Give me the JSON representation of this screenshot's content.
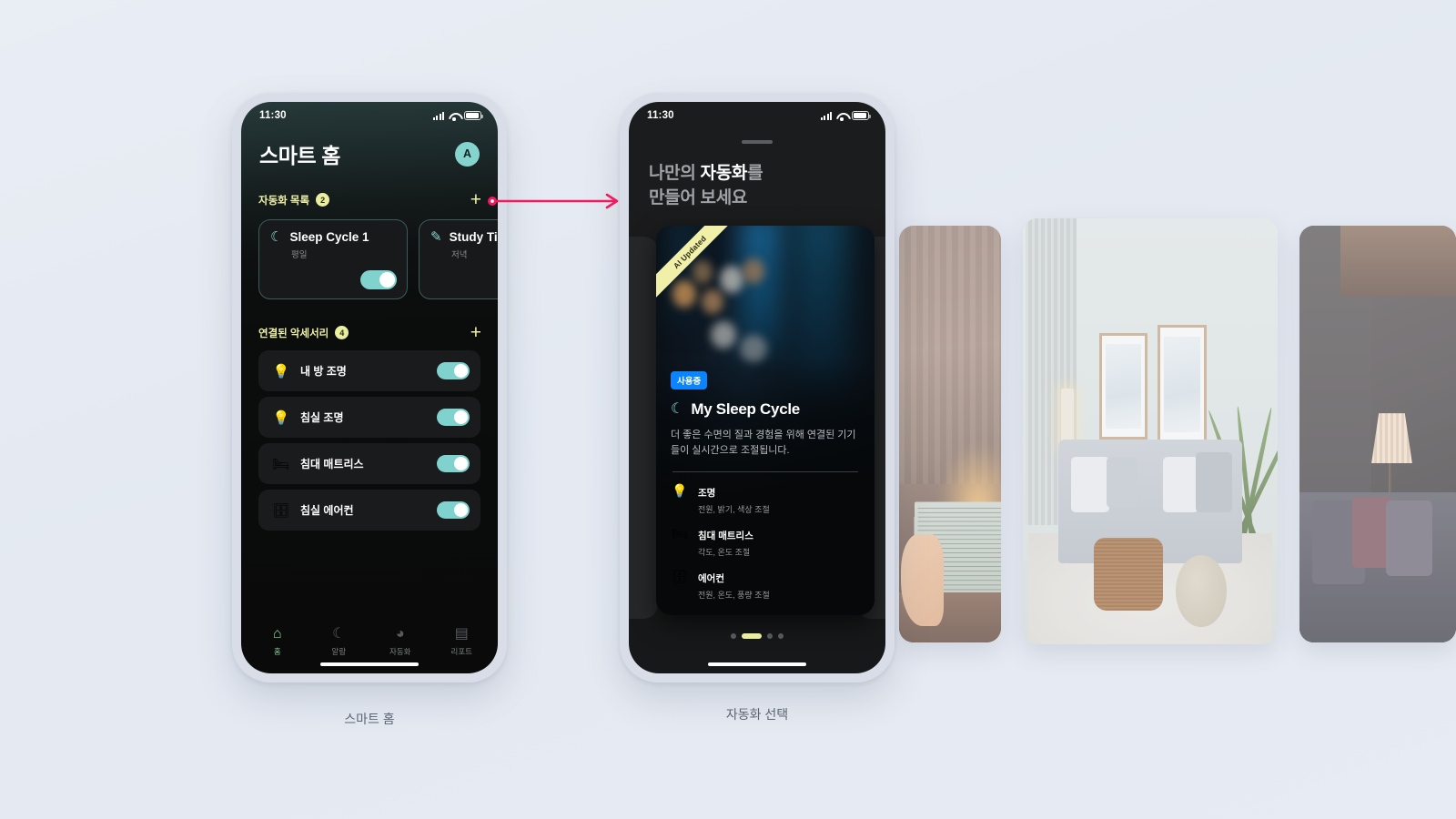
{
  "background_color": "#e7ebf3",
  "accent_colors": {
    "teal": "#7fd2cd",
    "yellow": "#e9eea0",
    "blue_badge": "#0a84ff",
    "arrow_pink": "#f2195f",
    "nav_active_green": "#8fd49a"
  },
  "phone_smart_home": {
    "caption": "스마트 홈",
    "status_bar": {
      "time": "11:30",
      "signal_icon": "cellular-signal-icon",
      "wifi_icon": "wifi-icon",
      "battery_icon": "battery-icon"
    },
    "header": {
      "title": "스마트 홈",
      "avatar_initial": "A"
    },
    "automation_section": {
      "label": "자동화 목록",
      "count": "2",
      "add_label": "+",
      "cards": [
        {
          "icon": "moon-icon",
          "glyph": "☾",
          "name": "Sleep Cycle 1",
          "subtitle": "평일",
          "toggle_on": true
        },
        {
          "icon": "pencil-icon",
          "glyph": "✎",
          "name": "Study Time",
          "subtitle": "저녁",
          "toggle_on": false
        }
      ]
    },
    "accessories_section": {
      "label": "연결된 악세서리",
      "count": "4",
      "add_label": "+",
      "items": [
        {
          "icon": "lightbulb-icon",
          "glyph": "💡",
          "name": "내 방 조명",
          "toggle_on": true
        },
        {
          "icon": "lightbulb-icon",
          "glyph": "💡",
          "name": "침실 조명",
          "toggle_on": true
        },
        {
          "icon": "bed-icon",
          "glyph": "🛏",
          "name": "침대 매트리스",
          "toggle_on": true
        },
        {
          "icon": "air-conditioner-icon",
          "glyph": "🗄",
          "name": "침실 에어컨",
          "toggle_on": true
        }
      ]
    },
    "tabbar": [
      {
        "icon": "home-icon",
        "glyph": "⌂",
        "label": "홈",
        "active": true
      },
      {
        "icon": "moon-icon",
        "glyph": "☾",
        "label": "알람",
        "active": false
      },
      {
        "icon": "clock-icon",
        "glyph": "◕",
        "label": "자동화",
        "active": false
      },
      {
        "icon": "report-icon",
        "glyph": "▤",
        "label": "리포트",
        "active": false
      }
    ]
  },
  "phone_automation": {
    "caption": "자동화 선택",
    "status_bar": {
      "time": "11:30",
      "signal_icon": "cellular-signal-icon",
      "wifi_icon": "wifi-icon",
      "battery_icon": "battery-icon"
    },
    "title_line1_normal": "나만의 ",
    "title_line1_bold": "자동화",
    "title_line1_tail": "를",
    "title_line2": "만들어 보세요",
    "hero_card": {
      "ribbon": "AI Updated",
      "badge": "사용중",
      "icon": "moon-icon",
      "glyph": "☾",
      "name": "My Sleep Cycle",
      "description": "더 좋은 수면의 질과 경험을 위해 연결된 기기들이 실시간으로 조절됩니다.",
      "features": [
        {
          "icon": "lightbulb-icon",
          "glyph": "💡",
          "name": "조명",
          "detail": "전원, 밝기, 색상 조절"
        },
        {
          "icon": "bed-icon",
          "glyph": "🛏",
          "name": "침대 매트리스",
          "detail": "각도, 온도 조절"
        },
        {
          "icon": "air-conditioner-icon",
          "glyph": "🗄",
          "name": "에어컨",
          "detail": "전원, 온도, 풍량 조절"
        }
      ]
    },
    "pagination": {
      "total": 4,
      "active_index": 1
    }
  },
  "photo_cards": [
    {
      "name": "desk-workspace-photo"
    },
    {
      "name": "living-room-photo"
    },
    {
      "name": "lounge-evening-photo"
    }
  ],
  "connector": {
    "name": "flow-arrow",
    "color": "#f2195f"
  }
}
